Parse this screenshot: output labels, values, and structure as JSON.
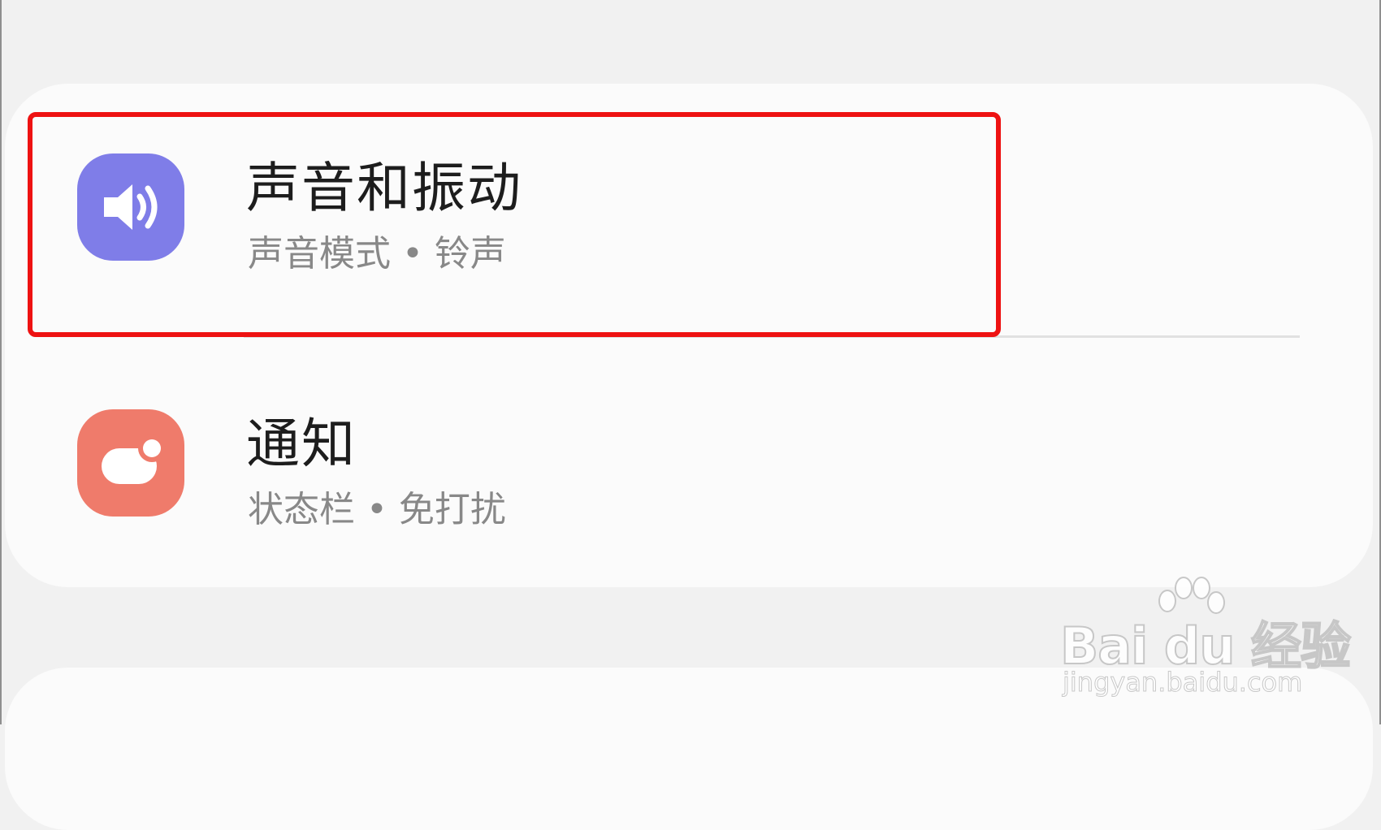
{
  "settings": {
    "items": [
      {
        "title": "声音和振动",
        "subtitle": "声音模式 • 铃声",
        "icon": "speaker-icon",
        "icon_color": "#7f7de8",
        "highlighted": true
      },
      {
        "title": "通知",
        "subtitle": "状态栏 • 免打扰",
        "icon": "notification-icon",
        "icon_color": "#ef7b6b",
        "highlighted": false
      }
    ]
  },
  "highlight_color": "#ee1212",
  "watermark": {
    "logo": "Bai du 经验",
    "url": "jingyan.baidu.com"
  }
}
